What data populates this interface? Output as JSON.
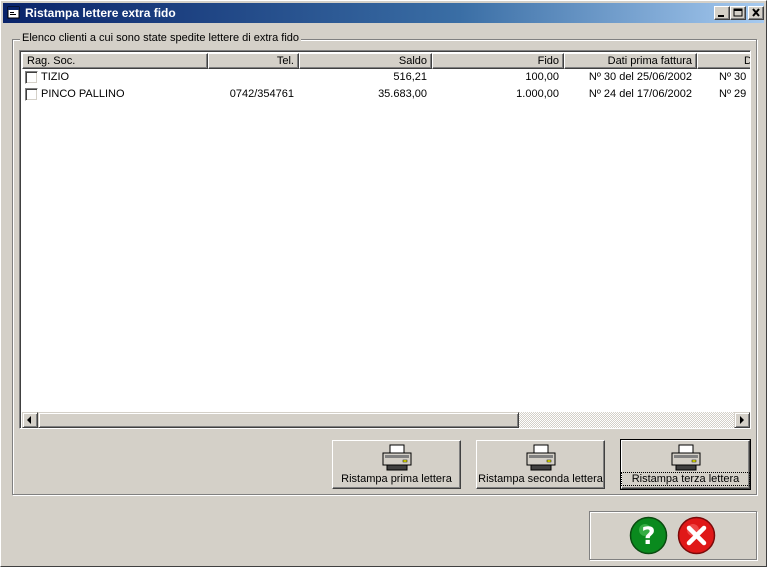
{
  "window": {
    "title": "Ristampa lettere extra fido",
    "icon": "form-icon"
  },
  "group": {
    "label": "Elenco clienti a cui sono state spedite lettere di extra fido"
  },
  "table": {
    "columns": [
      "Rag. Soc.",
      "Tel.",
      "Saldo",
      "Fido",
      "Dati prima fattura",
      "D"
    ],
    "rows": [
      {
        "checked": false,
        "rag_soc": "TIZIO",
        "tel": "",
        "saldo": "516,21",
        "fido": "100,00",
        "prima_fattura": "Nº 30 del 25/06/2002",
        "extra": "Nº 30"
      },
      {
        "checked": false,
        "rag_soc": "PINCO PALLINO",
        "tel": "0742/354761",
        "saldo": "35.683,00",
        "fido": "1.000,00",
        "prima_fattura": "Nº 24 del 17/06/2002",
        "extra": "Nº 29"
      }
    ]
  },
  "buttons": {
    "prima": "Ristampa prima lettera",
    "seconda": "Ristampa seconda lettera",
    "terza": "Ristampa terza lettera",
    "print_icon": "printer-icon",
    "help_icon": "help-icon",
    "close_icon": "close-icon"
  },
  "colors": {
    "titlebar_start": "#0a246a",
    "titlebar_end": "#a6caf0",
    "face": "#d4d0c8",
    "help_green": "#0a8a1e",
    "close_red": "#e01818"
  }
}
